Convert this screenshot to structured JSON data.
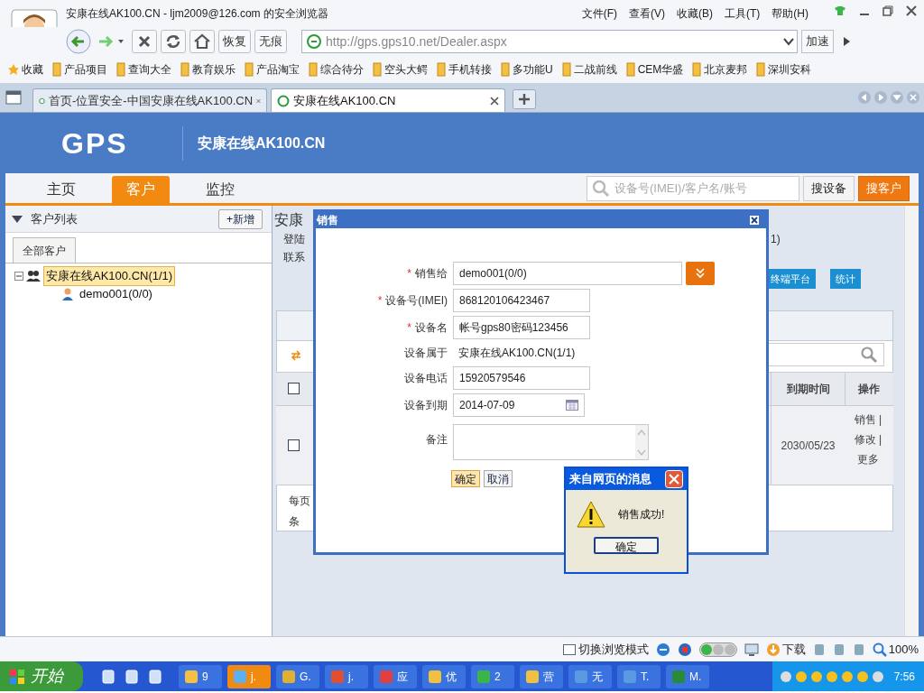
{
  "browser": {
    "title": "安康在线AK100.CN - ljm2009@126.com 的安全浏览器",
    "menu": [
      "文件(F)",
      "查看(V)",
      "收藏(B)",
      "工具(T)",
      "帮助(H)"
    ],
    "tool_buttons": [
      "恢复",
      "无痕"
    ],
    "address": "http://gps.gps10.net/Dealer.aspx",
    "speedup": "加速",
    "favorites": "收藏",
    "bookmarks": [
      "产品项目",
      "查询大全",
      "教育娱乐",
      "产品淘宝",
      "综合待分",
      "空头大鳄",
      "手机转接",
      "多功能U",
      "二战前线",
      "CEM华盛",
      "北京麦邦",
      "深圳安科"
    ],
    "tabs": [
      {
        "label": "首页-位置安全-中国安康在线AK100.CN",
        "selected": false
      },
      {
        "label": "安康在线AK100.CN",
        "selected": true
      }
    ]
  },
  "header": {
    "logo": "GPS",
    "site": "安康在线AK100.CN"
  },
  "nav": [
    {
      "label": "主页",
      "selected": false
    },
    {
      "label": "客户",
      "selected": true
    },
    {
      "label": "监控",
      "selected": false
    }
  ],
  "search": {
    "placeholder": "设备号(IMEI)/客户名/账号",
    "buttons": [
      "搜设备",
      "搜客户"
    ]
  },
  "sidebar": {
    "title": "客户列表",
    "add": "+新增",
    "tab": "全部客户",
    "tree": [
      {
        "label": "安康在线AK100.CN(1/1)",
        "selected": true,
        "children": [
          {
            "label": "demo001(0/0)",
            "selected": false
          }
        ]
      }
    ]
  },
  "content": {
    "title": "安康",
    "lines": [
      "登陆",
      "联系"
    ],
    "fragment": "1)",
    "buttons": [
      "终端平台",
      "统计"
    ],
    "table": {
      "select_all": {
        "checked": false
      },
      "columns": [
        "到期时间",
        "操作"
      ],
      "rows": [
        {
          "checked": false,
          "expiry": "2030/05/23",
          "actions": "销售 | 修改 | 更多"
        }
      ]
    },
    "pager": [
      "每页",
      "条"
    ]
  },
  "dialog": {
    "title": "销售",
    "required_mark": "*",
    "fields": [
      {
        "label": "销售给",
        "required": true,
        "kind": "select",
        "value": "demo001(0/0)"
      },
      {
        "label": "设备号(IMEI)",
        "required": true,
        "kind": "input",
        "value": "868120106423467"
      },
      {
        "label": "设备名",
        "required": true,
        "kind": "input",
        "value": "帐号gps80密码123456"
      },
      {
        "label": "设备属于",
        "required": false,
        "kind": "text",
        "value": "安康在线AK100.CN(1/1)"
      },
      {
        "label": "设备电话",
        "required": false,
        "kind": "input",
        "value": "15920579546"
      },
      {
        "label": "设备到期",
        "required": false,
        "kind": "date",
        "value": "2014-07-09"
      },
      {
        "label": "备注",
        "required": false,
        "kind": "textarea"
      }
    ],
    "buttons": [
      "确定",
      "取消"
    ]
  },
  "alert": {
    "title": "来自网页的消息",
    "message": "销售成功!",
    "button": "确定"
  },
  "status_bar": {
    "mode": "切换浏览模式",
    "download": "下载",
    "zoom": "100%"
  },
  "taskbar": {
    "start": "开始",
    "items": [
      {
        "label": "9",
        "selected": false
      },
      {
        "label": "j.",
        "selected": true
      },
      {
        "label": "G.",
        "selected": false
      },
      {
        "label": "j.",
        "selected": false
      },
      {
        "label": "应",
        "selected": false
      },
      {
        "label": "优",
        "selected": false
      },
      {
        "label": "2",
        "selected": false
      },
      {
        "label": "营",
        "selected": false
      },
      {
        "label": "无",
        "selected": false
      },
      {
        "label": "T.",
        "selected": false
      },
      {
        "label": "M.",
        "selected": false
      }
    ],
    "clock": "7:56"
  }
}
